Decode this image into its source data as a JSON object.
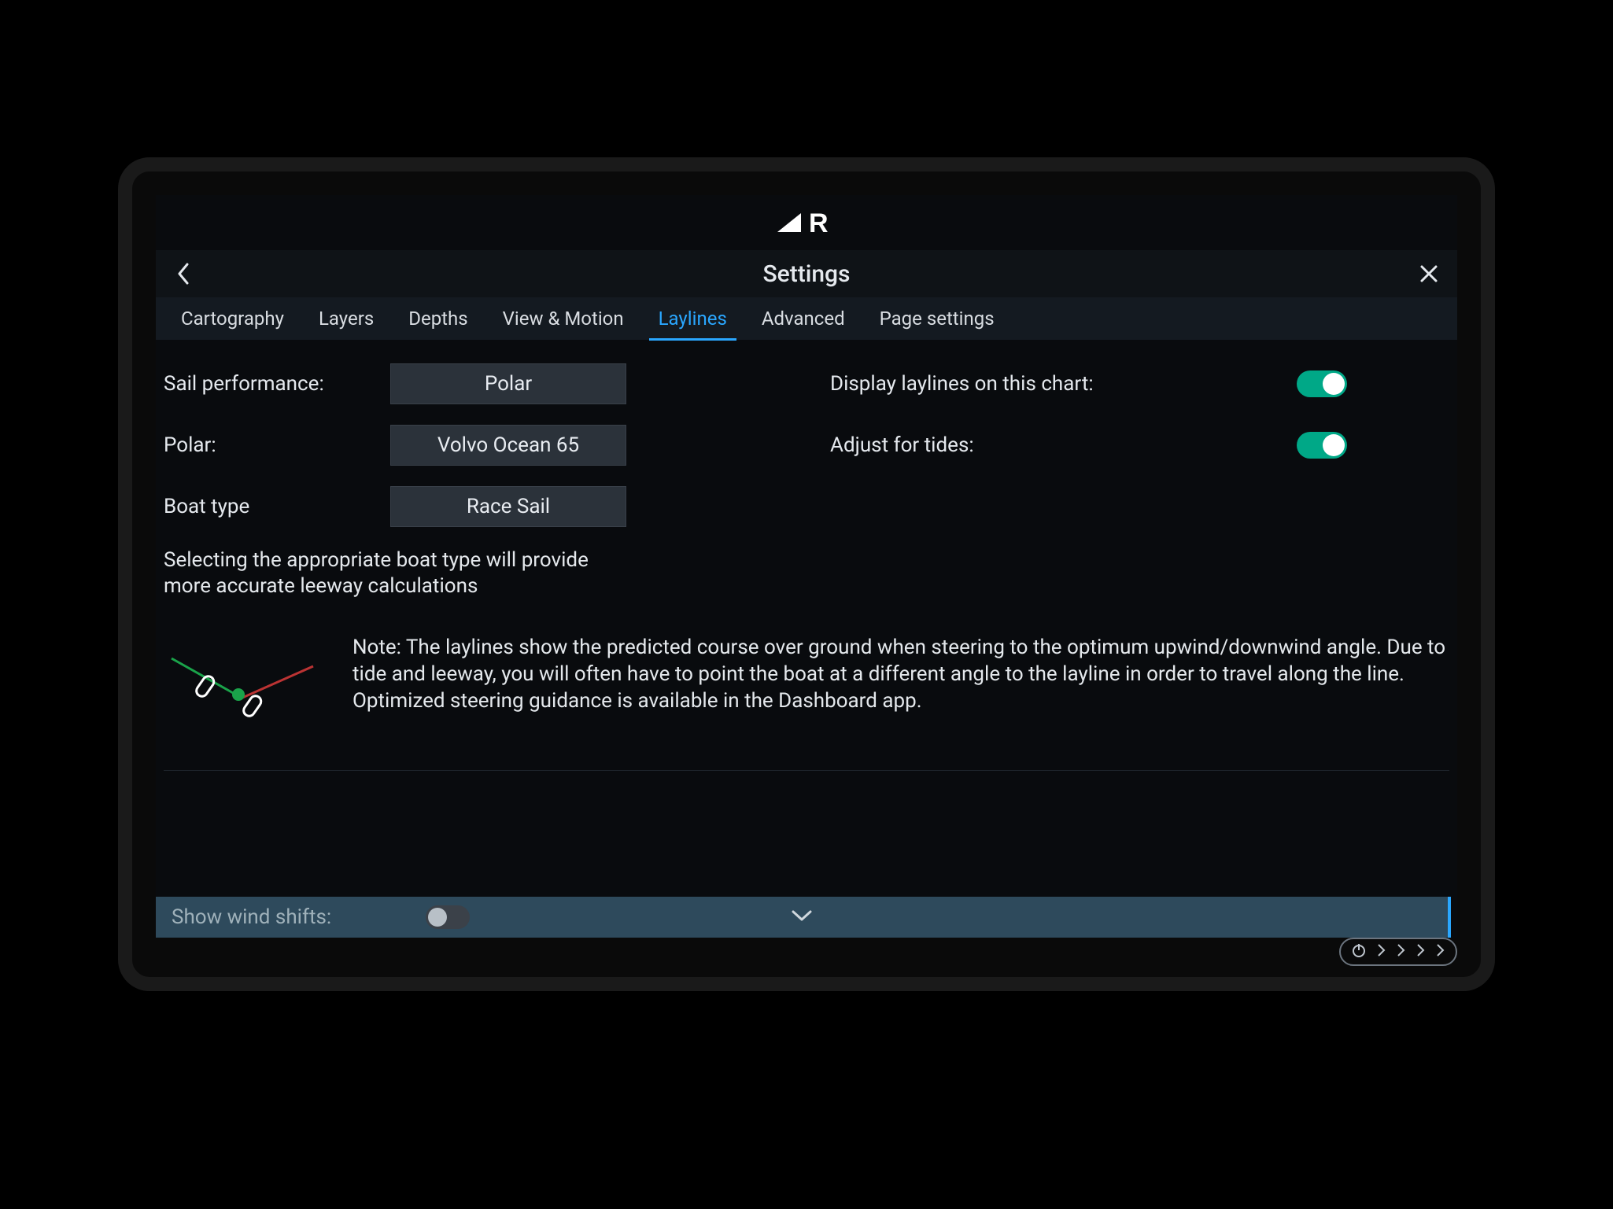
{
  "brand": "R",
  "header": {
    "title": "Settings"
  },
  "tabs": [
    {
      "label": "Cartography",
      "active": false
    },
    {
      "label": "Layers",
      "active": false
    },
    {
      "label": "Depths",
      "active": false
    },
    {
      "label": "View & Motion",
      "active": false
    },
    {
      "label": "Laylines",
      "active": true
    },
    {
      "label": "Advanced",
      "active": false
    },
    {
      "label": "Page settings",
      "active": false
    }
  ],
  "left": {
    "sail_performance": {
      "label": "Sail performance:",
      "value": "Polar"
    },
    "polar": {
      "label": "Polar:",
      "value": "Volvo Ocean 65"
    },
    "boat_type": {
      "label": "Boat type",
      "value": "Race Sail"
    },
    "boat_note": "Selecting the appropriate boat type will provide more accurate leeway calculations"
  },
  "right": {
    "display_laylines": {
      "label": "Display laylines on this chart:",
      "on": true
    },
    "adjust_tides": {
      "label": "Adjust for tides:",
      "on": true
    }
  },
  "note": "Note:  The laylines show the predicted course over ground when steering to the optimum upwind/downwind angle. Due to tide and leeway, you will often have to point the boat at a different angle to the layline in order to travel along the line.\nOptimized steering guidance is available in the Dashboard app.",
  "footer": {
    "show_wind_shifts": {
      "label": "Show wind shifts:",
      "on": false
    }
  }
}
